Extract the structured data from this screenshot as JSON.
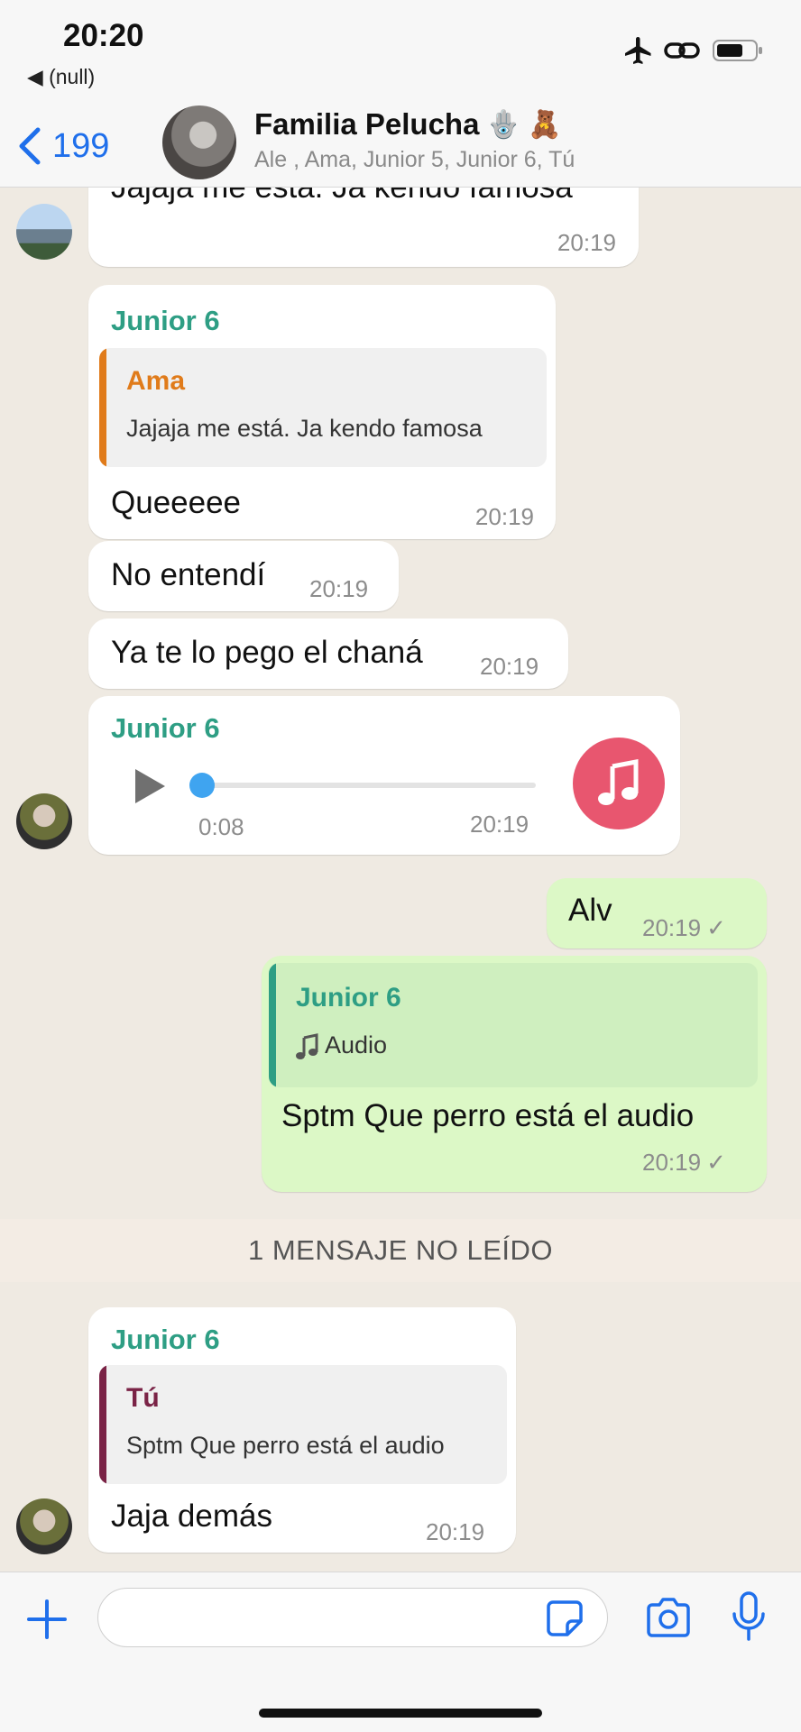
{
  "status_bar": {
    "time": "20:20",
    "back_app": "◀ (null)"
  },
  "header": {
    "back_count": "199",
    "title": "Familia Pelucha",
    "title_emoji": "🪬 🧸",
    "subtitle": "Ale , Ama, Junior 5, Junior 6, Tú"
  },
  "messages": [
    {
      "text": "Jajaja me está. Ja kendo famosa",
      "time": "20:19"
    },
    {
      "sender": "Junior 6",
      "quote_name": "Ama",
      "quote_text": "Jajaja me está. Ja kendo famosa",
      "text": "Queeeee",
      "time": "20:19"
    },
    {
      "text": "No entendí",
      "time": "20:19"
    },
    {
      "text": "Ya te lo pego el chaná",
      "time": "20:19"
    },
    {
      "sender": "Junior 6",
      "audio_duration": "0:08",
      "audio_progress": 0.0,
      "time": "20:19"
    },
    {
      "text": "Alv",
      "time": "20:19",
      "tick": "✓"
    },
    {
      "quote_name": "Junior 6",
      "quote_text": "Audio",
      "text": "Sptm Que perro está el audio",
      "time": "20:19",
      "tick": "✓"
    },
    {
      "sender": "Junior 6",
      "quote_name": "Tú",
      "quote_text": "Sptm Que perro está el audio",
      "text": "Jaja demás",
      "time": "20:19"
    }
  ],
  "unread_divider": "1 MENSAJE NO LEÍDO",
  "icons": [
    "back-chevron-icon",
    "airplane-icon",
    "link-icon",
    "battery-icon",
    "play-icon",
    "music-note-icon",
    "plus-icon",
    "sticker-icon",
    "camera-icon",
    "microphone-icon"
  ],
  "colors": {
    "accent": "#1f6feb",
    "sender": "#2e9e84",
    "outgoing": "#dcf8c6",
    "quote_ama": "#e07b1a",
    "quote_tu": "#7a2346",
    "quote_junior": "#2e9e84",
    "audio_dot": "#3fa4f0",
    "music_circle": "#e8566f"
  }
}
